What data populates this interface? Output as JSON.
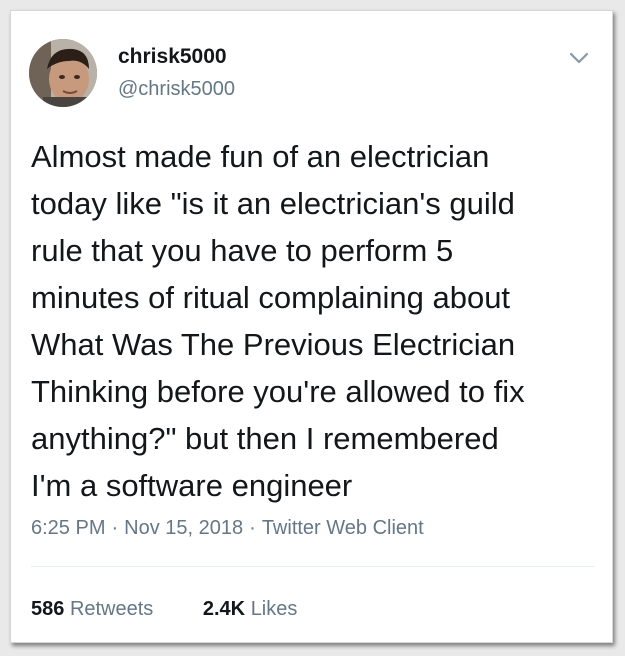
{
  "tweet": {
    "author": {
      "display_name": "chrisk5000",
      "handle": "@chrisk5000"
    },
    "text": "Almost made fun of an electrician\ntoday like \"is it an electrician's guild\nrule that you have to perform 5\nminutes of ritual complaining about\nWhat Was The Previous Electrician\nThinking before you're allowed to fix\nanything?\" but then I remembered\nI'm a software engineer",
    "time": "6:25 PM",
    "date": "Nov 15, 2018",
    "client": "Twitter Web Client",
    "separator": "·",
    "retweets_count": "586",
    "retweets_label": "Retweets",
    "likes_count": "2.4K",
    "likes_label": "Likes"
  },
  "icons": {
    "menu": "chevron-down-icon"
  },
  "colors": {
    "text_primary": "#14171a",
    "text_secondary": "#657786",
    "divider": "#e6ecf0",
    "caret": "#8899a6"
  }
}
